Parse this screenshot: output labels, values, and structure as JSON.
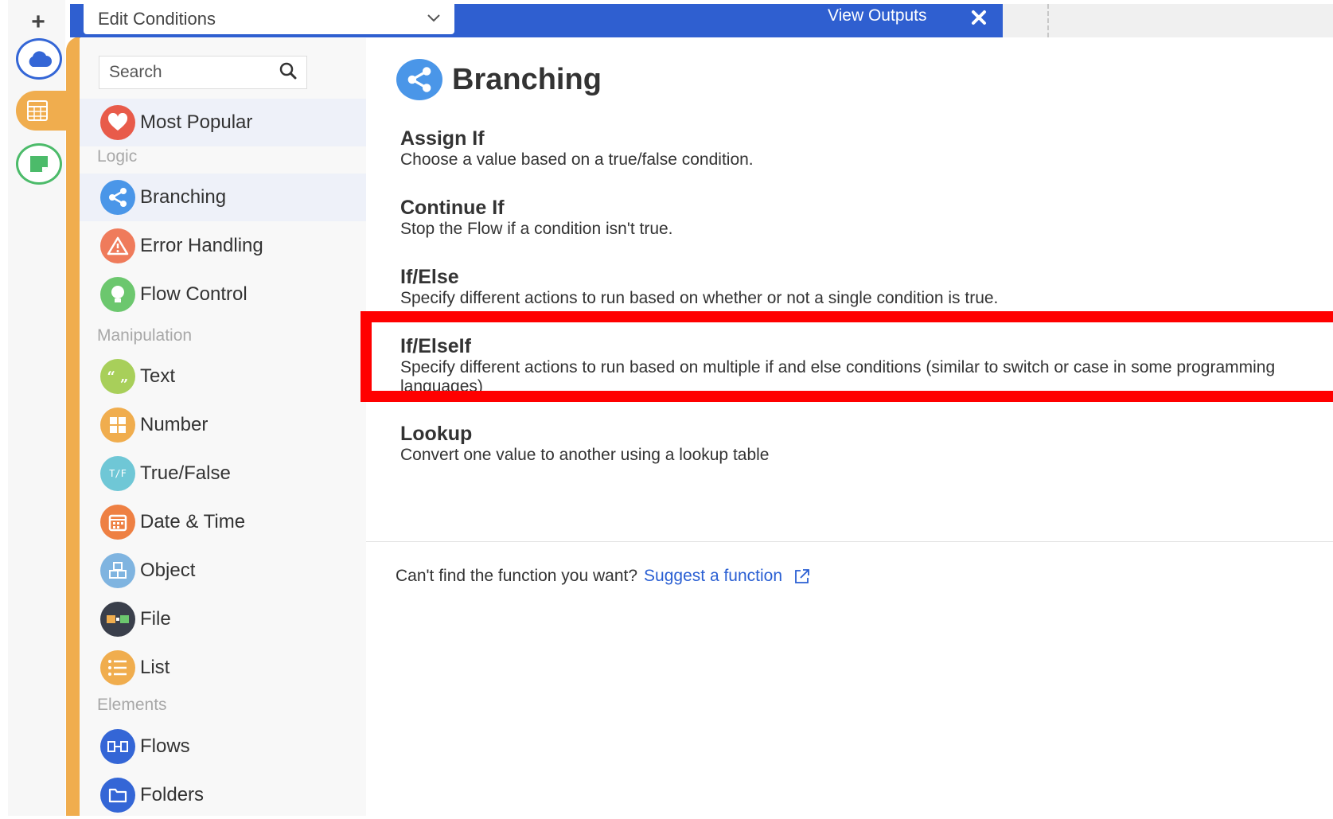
{
  "topbar": {
    "condition_select": "Edit Conditions",
    "view_outputs": "View Outputs"
  },
  "sidebar": {
    "search_placeholder": "Search",
    "most_popular": "Most Popular",
    "sections": {
      "logic": "Logic",
      "manipulation": "Manipulation",
      "elements": "Elements"
    },
    "items": [
      {
        "label": "Branching",
        "icon": "share-icon",
        "color": "#4a96e8"
      },
      {
        "label": "Error Handling",
        "icon": "warning-icon",
        "color": "#ef7b5b"
      },
      {
        "label": "Flow Control",
        "icon": "lightbulb-icon",
        "color": "#6cc76e"
      },
      {
        "label": "Text",
        "icon": "quote-icon",
        "color": "#a8cf5a"
      },
      {
        "label": "Number",
        "icon": "calculator-icon",
        "color": "#f0ad4e"
      },
      {
        "label": "True/False",
        "icon": "true-false-icon",
        "color": "#6fc7d6"
      },
      {
        "label": "Date & Time",
        "icon": "calendar-icon",
        "color": "#ee8043"
      },
      {
        "label": "Object",
        "icon": "cube-icon",
        "color": "#7fb4e0"
      },
      {
        "label": "File",
        "icon": "file-icon",
        "color": "#3a3f4b"
      },
      {
        "label": "List",
        "icon": "list-icon",
        "color": "#f0ad4e"
      },
      {
        "label": "Flows",
        "icon": "flow-icon",
        "color": "#3466d6"
      },
      {
        "label": "Folders",
        "icon": "folder-icon",
        "color": "#3466d6"
      }
    ]
  },
  "main": {
    "title": "Branching",
    "functions": [
      {
        "name": "Assign If",
        "description": "Choose a value based on a true/false condition."
      },
      {
        "name": "Continue If",
        "description": "Stop the Flow if a condition isn't true."
      },
      {
        "name": "If/Else",
        "description": "Specify different actions to run based on whether or not a single condition is true."
      },
      {
        "name": "If/ElseIf",
        "description": "Specify different actions to run based on multiple if and else conditions (similar to switch or case in some programming languages)"
      },
      {
        "name": "Lookup",
        "description": "Convert one value to another using a lookup table"
      }
    ],
    "footer_text": "Can't find the function you want?",
    "footer_link": "Suggest a function"
  },
  "colors": {
    "topbar": "#2f5fd0",
    "accent_orange": "#f0ad4e",
    "highlight": "#ff0000",
    "link": "#2a5fd3"
  }
}
